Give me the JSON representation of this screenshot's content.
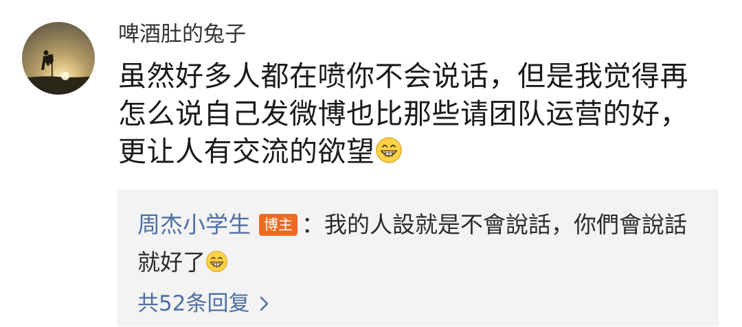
{
  "comment": {
    "username": "啤酒肚的兔子",
    "text": "虽然好多人都在喷你不会说话，但是我觉得再怎么说自己发微博也比那些请团队运营的好，更让人有交流的欲望",
    "emoji": "grin-emoji"
  },
  "reply": {
    "author": "周杰小学生",
    "badge": "博主",
    "separator": "：",
    "text": "我的人設就是不會說話，你們會說話就好了",
    "emoji": "grin-emoji",
    "more_label": "共52条回复",
    "more_icon": "chevron-right-icon"
  },
  "colors": {
    "link_blue": "#4e6ea5",
    "badge_orange": "#f06a20",
    "reply_bg": "#f3f3f3"
  }
}
